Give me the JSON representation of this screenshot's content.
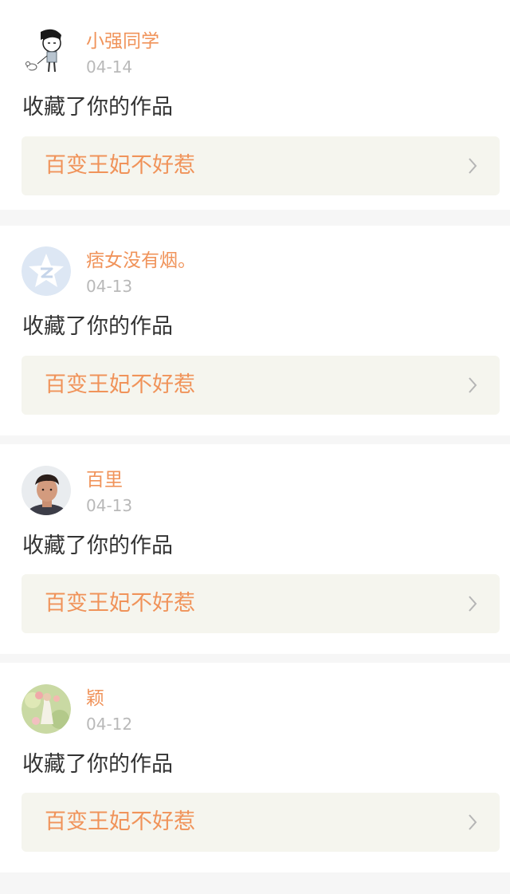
{
  "notifications": [
    {
      "username": "小强同学",
      "date": "04-14",
      "action": "收藏了你的作品",
      "work_title": "百变王妃不好惹",
      "avatar_icon": "cartoon-boy-avatar"
    },
    {
      "username": "痞女没有烟。",
      "date": "04-13",
      "action": "收藏了你的作品",
      "work_title": "百变王妃不好惹",
      "avatar_icon": "qzone-star-avatar"
    },
    {
      "username": "百里",
      "date": "04-13",
      "action": "收藏了你的作品",
      "work_title": "百变王妃不好惹",
      "avatar_icon": "photo-avatar"
    },
    {
      "username": "颖",
      "date": "04-12",
      "action": "收藏了你的作品",
      "work_title": "百变王妃不好惹",
      "avatar_icon": "flower-illustration-avatar"
    }
  ],
  "colors": {
    "accent": "#f0935a",
    "tab_indicator": "#ee6ea0",
    "date_text": "#b9b9b9",
    "body_text": "#333333",
    "work_bg": "#f5f5ee",
    "page_bg": "#f6f6f6"
  }
}
